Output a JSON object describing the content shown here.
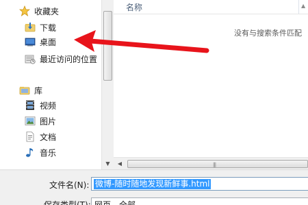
{
  "nav": {
    "favorites_label": "收藏夹",
    "items": [
      {
        "label": "收藏夹",
        "icon": "star-icon"
      },
      {
        "label": "下载",
        "icon": "downloads-folder-icon"
      },
      {
        "label": "桌面",
        "icon": "desktop-icon"
      },
      {
        "label": "最近访问的位置",
        "icon": "recent-places-icon"
      },
      {
        "label": "库",
        "icon": "libraries-icon"
      },
      {
        "label": "视频",
        "icon": "videos-icon"
      },
      {
        "label": "图片",
        "icon": "pictures-icon"
      },
      {
        "label": "文档",
        "icon": "documents-icon"
      },
      {
        "label": "音乐",
        "icon": "music-icon"
      }
    ]
  },
  "list": {
    "column_name": "名称",
    "empty_message": "没有与搜索条件匹配"
  },
  "form": {
    "filename_label": "文件名(N):",
    "filename_value": "微博-随时随地发现新鲜事.html",
    "savetype_label": "保存类型(T):",
    "savetype_value": "网页，全部"
  },
  "colors": {
    "annotation_arrow": "#e8141b",
    "selection": "#3399ff"
  }
}
